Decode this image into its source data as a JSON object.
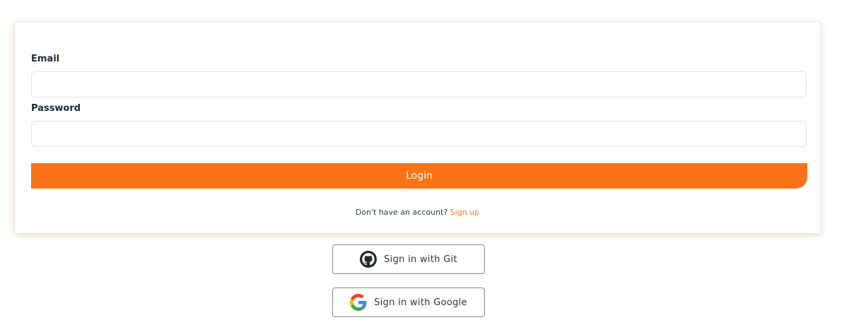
{
  "form": {
    "email_label": "Email",
    "email_value": "",
    "password_label": "Password",
    "password_value": "",
    "login_label": "Login",
    "signup_prompt": "Don't have an account?",
    "signup_link": "Sign up"
  },
  "oauth": {
    "git_label": "Sign in with Git",
    "git_icon": "github-icon",
    "google_label": "Sign in with Google",
    "google_icon": "google-icon"
  },
  "colors": {
    "accent": "#f97316",
    "google_blue": "#4285F4",
    "google_red": "#EA4335",
    "google_yellow": "#FBBC05",
    "google_green": "#34A853"
  }
}
